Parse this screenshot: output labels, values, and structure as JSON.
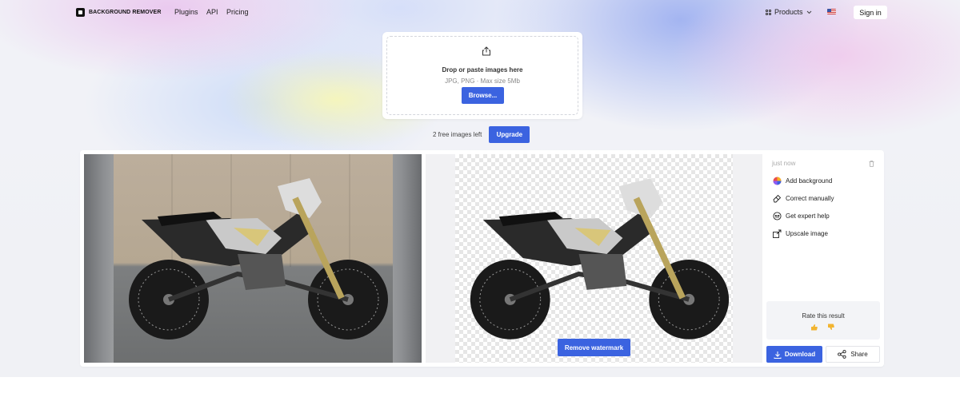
{
  "brand": {
    "name": "BACKGROUND REMOVER"
  },
  "nav": {
    "links": [
      "Plugins",
      "API",
      "Pricing"
    ],
    "products_label": "Products",
    "signin_label": "Sign in"
  },
  "upload": {
    "title": "Drop or paste images here",
    "subtitle": "JPG, PNG · Max size 5Mb",
    "browse_label": "Browse..."
  },
  "quota": {
    "text": "2 free images left",
    "upgrade_label": "Upgrade"
  },
  "result": {
    "timestamp": "just now",
    "remove_watermark_label": "Remove watermark",
    "actions": [
      {
        "label": "Add background",
        "icon": "color-wheel-icon"
      },
      {
        "label": "Correct manually",
        "icon": "eraser-icon"
      },
      {
        "label": "Get expert help",
        "icon": "expert-help-icon"
      },
      {
        "label": "Upscale image",
        "icon": "upscale-icon"
      }
    ],
    "rating": {
      "title": "Rate this result"
    },
    "download_label": "Download",
    "share_label": "Share"
  },
  "colors": {
    "accent": "#3b63e0"
  }
}
